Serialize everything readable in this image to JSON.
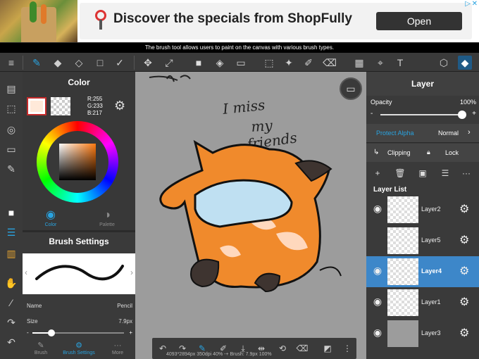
{
  "ad": {
    "title": "Discover the specials from ShopFully",
    "open_label": "Open",
    "info": "▷",
    "close": "✕"
  },
  "caption": "The brush tool allows users to paint on the canvas with various brush types.",
  "color_panel": {
    "title": "Color",
    "r": "R:255",
    "g": "G:233",
    "b": "B:217",
    "tab_color": "Color",
    "tab_palette": "Palette"
  },
  "brush_panel": {
    "title": "Brush Settings",
    "name_label": "Name",
    "name_value": "Pencil",
    "size_label": "Size",
    "size_value": "7.9px",
    "tab_brush": "Brush",
    "tab_settings": "Brush Settings",
    "tab_more": "More"
  },
  "canvas": {
    "status": "4093*2894px 350dpi 40% -+ Brush: 7.9px 100%"
  },
  "layer_panel": {
    "title": "Layer",
    "opacity_label": "Opacity",
    "opacity_value": "100%",
    "minus": "-",
    "plus": "+",
    "protect_alpha": "Protect Alpha",
    "blend_mode": "Normal",
    "clipping": "Clipping",
    "lock": "Lock",
    "list_label": "Layer List",
    "layers": [
      {
        "name": "Layer2"
      },
      {
        "name": "Layer5"
      },
      {
        "name": "Layer4"
      },
      {
        "name": "Layer1"
      },
      {
        "name": "Layer3"
      }
    ]
  },
  "colors": {
    "accent": "#29a3e0",
    "selected_layer": "#3d87c9",
    "current_color": "#ffe9d9"
  }
}
